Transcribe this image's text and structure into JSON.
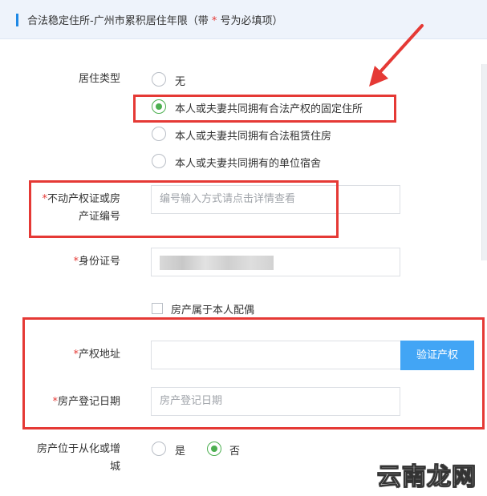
{
  "header": {
    "title_prefix": "合法稳定住所-广州市累积居住年限（带",
    "star": "*",
    "title_suffix": "号为必填项）"
  },
  "residence_type": {
    "label": "居住类型",
    "options": [
      {
        "label": "无",
        "checked": false
      },
      {
        "label": "本人或夫妻共同拥有合法产权的固定住所",
        "checked": true
      },
      {
        "label": "本人或夫妻共同拥有合法租赁住房",
        "checked": false
      },
      {
        "label": "本人或夫妻共同拥有的单位宿舍",
        "checked": false
      }
    ]
  },
  "property_cert": {
    "req": "*",
    "label_line1": "不动产权证或房",
    "label_line2": "产证编号",
    "placeholder": "编号输入方式请点击详情查看"
  },
  "id_number": {
    "req": "*",
    "label": "身份证号"
  },
  "spouse_checkbox": {
    "label": "房产属于本人配偶",
    "checked": false
  },
  "property_address": {
    "req": "*",
    "label": "产权地址",
    "value": "",
    "verify_button": "验证产权"
  },
  "register_date": {
    "req": "*",
    "label": "房产登记日期",
    "placeholder": "房产登记日期"
  },
  "conghua": {
    "label_line1": "房产位于从化或增",
    "label_line2": "城",
    "options": [
      {
        "label": "是",
        "checked": false
      },
      {
        "label": "否",
        "checked": true
      }
    ]
  },
  "watermark": "云南龙网",
  "colors": {
    "accent": "#1e88e5",
    "button": "#42a5f5",
    "highlight": "#e53935",
    "radio_checked": "#4caf50"
  }
}
